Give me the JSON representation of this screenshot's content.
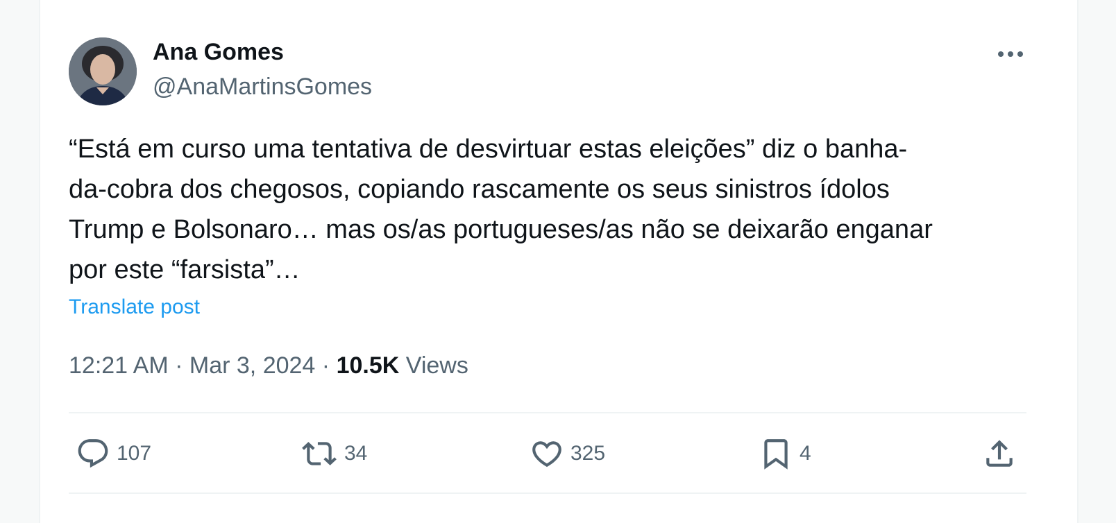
{
  "post": {
    "author_name": "Ana Gomes",
    "author_handle": "@AnaMartinsGomes",
    "text_lines": [
      "“Está em curso uma tentativa de desvirtuar estas eleições” diz o banha-",
      "da-cobra dos chegosos, copiando rascamente os seus sinistros ídolos",
      "Trump e Bolsonaro… mas os/as portugueses/as não se deixarão enganar",
      "por este “farsista”…"
    ],
    "translate_label": "Translate post",
    "time": "12:21 AM",
    "separator": "·",
    "date": "Mar 3, 2024",
    "views_count": "10.5K",
    "views_label": "Views"
  },
  "actions": {
    "replies": "107",
    "reposts": "34",
    "likes": "325",
    "bookmarks": "4"
  },
  "icons": {
    "more": "more-horizontal-icon",
    "reply": "reply-icon",
    "repost": "repost-icon",
    "like": "heart-icon",
    "bookmark": "bookmark-icon",
    "share": "share-icon"
  },
  "colors": {
    "text": "#0f1419",
    "secondary": "#536471",
    "link": "#1d9bf0",
    "divider": "#eff3f4"
  }
}
